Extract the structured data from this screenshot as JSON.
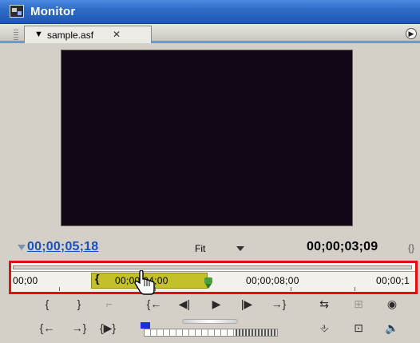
{
  "window": {
    "title": "Monitor",
    "app_icon": "monitor-app-icon"
  },
  "tabs": [
    {
      "label": "sample.asf",
      "menu_icon": "triangle-down-icon",
      "close_icon": "close-icon"
    }
  ],
  "tab_menu_icon": "circle-arrow-icon",
  "time": {
    "current": "00;00;05;18",
    "zoom": "Fit",
    "duration": "00;00;03;09"
  },
  "timeline": {
    "ticks": [
      "00;00",
      "00;00;04;00",
      "00;00;08;00",
      "00;00;1"
    ],
    "work_area_color": "#c4c02a",
    "outline_color": "#e01010"
  },
  "controls": {
    "row1": [
      {
        "name": "mark-in-button",
        "glyph": "{"
      },
      {
        "name": "mark-out-button",
        "glyph": "}"
      },
      {
        "name": "set-unnumbered-marker-button",
        "glyph": "⌐"
      },
      {
        "name": "go-to-in-point-button",
        "glyph": "{←"
      },
      {
        "name": "step-back-button",
        "glyph": "◀|"
      },
      {
        "name": "play-button",
        "glyph": "▶"
      },
      {
        "name": "step-forward-button",
        "glyph": "|▶"
      },
      {
        "name": "go-to-out-point-button",
        "glyph": "→}"
      },
      {
        "name": "loop-button",
        "glyph": "⇆"
      },
      {
        "name": "safe-margins-button",
        "glyph": "⊞"
      },
      {
        "name": "output-button",
        "glyph": "◉"
      }
    ],
    "row2": [
      {
        "name": "go-to-previous-edit-button",
        "glyph": "{←"
      },
      {
        "name": "go-to-next-edit-button",
        "glyph": "→}"
      },
      {
        "name": "play-in-to-out-button",
        "glyph": "{▶}"
      },
      {
        "name": "insert-button",
        "glyph": "⎀"
      },
      {
        "name": "overlay-button",
        "glyph": "⊡"
      },
      {
        "name": "speaker-button",
        "glyph": "🔈"
      }
    ]
  }
}
